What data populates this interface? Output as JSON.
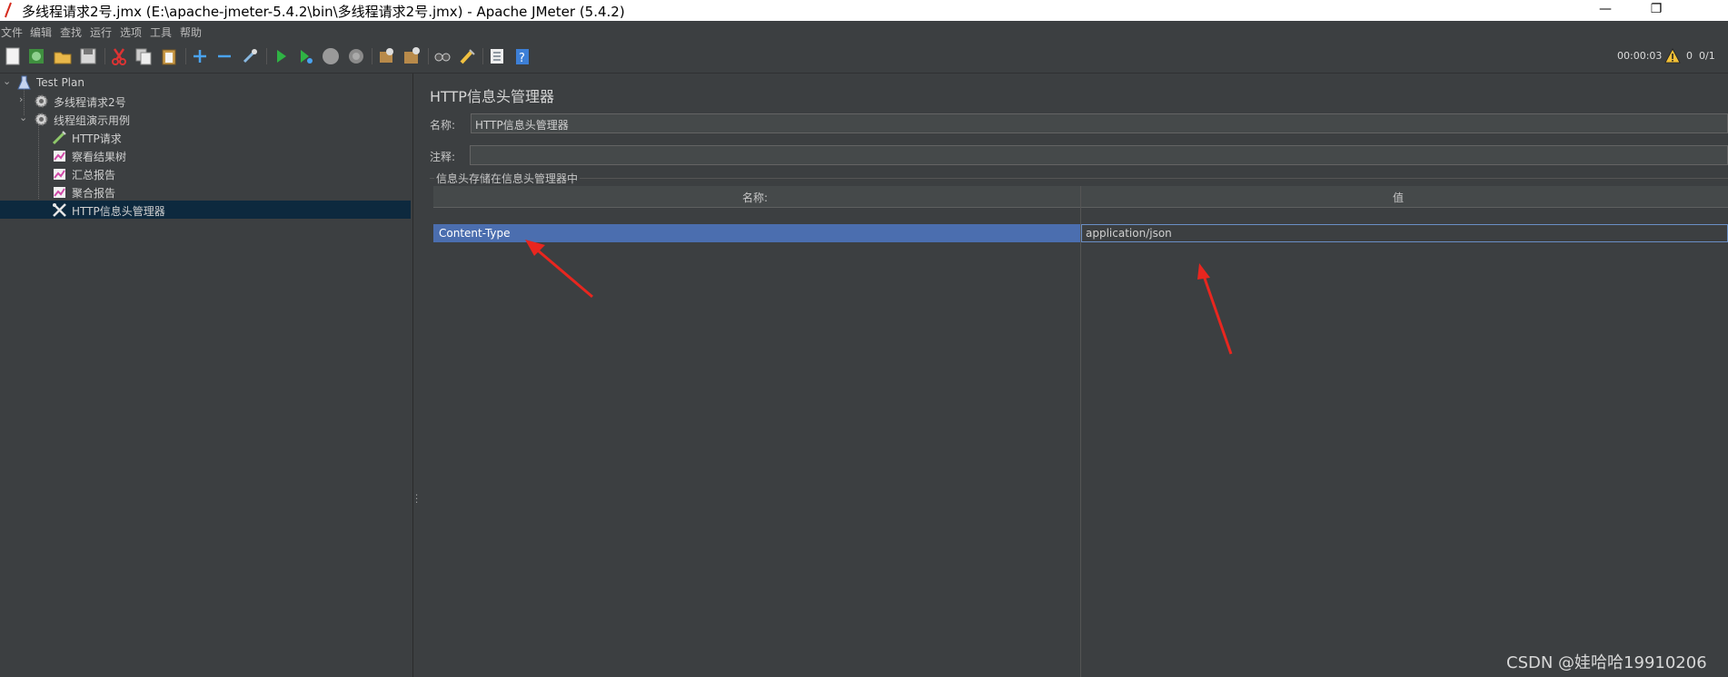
{
  "window": {
    "title": "多线程请求2号.jmx (E:\\apache-jmeter-5.4.2\\bin\\多线程请求2号.jmx) - Apache JMeter (5.4.2)",
    "minimize": "—",
    "restore": "❐",
    "close": "✕"
  },
  "menu": [
    "文件",
    "编辑",
    "查找",
    "运行",
    "选项",
    "工具",
    "帮助"
  ],
  "toolbar": {
    "icons": [
      "new-icon",
      "templates-icon",
      "open-icon",
      "save-icon",
      "cut-icon",
      "copy-icon",
      "paste-icon",
      "expand-icon",
      "collapse-icon",
      "toggle-icon",
      "start-icon",
      "start-no-pause-icon",
      "stop-icon",
      "shutdown-icon",
      "clear-icon",
      "clear-all-icon",
      "search-icon",
      "reset-search-icon",
      "function-helper-icon",
      "help-icon"
    ],
    "timer": "00:00:03",
    "warning_count": "0",
    "threads": "0/1"
  },
  "tree": {
    "items": [
      {
        "label": "Test Plan",
        "icon": "test-plan-icon"
      },
      {
        "label": "多线程请求2号",
        "icon": "thread-group-icon"
      },
      {
        "label": "线程组演示用例",
        "icon": "thread-group-icon"
      },
      {
        "label": "HTTP请求",
        "icon": "http-sampler-icon"
      },
      {
        "label": "察看结果树",
        "icon": "listener-icon"
      },
      {
        "label": "汇总报告",
        "icon": "listener-icon"
      },
      {
        "label": "聚合报告",
        "icon": "listener-icon"
      },
      {
        "label": "HTTP信息头管理器",
        "icon": "config-element-icon",
        "selected": true
      }
    ]
  },
  "panel": {
    "title": "HTTP信息头管理器",
    "name_label": "名称:",
    "name_value": "HTTP信息头管理器",
    "comment_label": "注释:",
    "comment_value": "",
    "group_title": "信息头存储在信息头管理器中",
    "table": {
      "columns": [
        "名称:",
        "值"
      ],
      "rows": [
        {
          "name": "Content-Type",
          "value": "application/json"
        }
      ]
    }
  },
  "annotation_color": "#e8261f",
  "selection_color": "#4b6eaf",
  "watermark": "CSDN @娃哈哈19910206"
}
